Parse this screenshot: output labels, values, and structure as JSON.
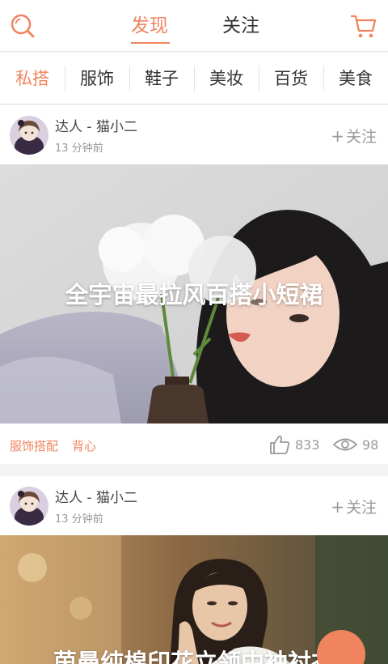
{
  "header": {
    "tabs": [
      {
        "label": "发现",
        "active": true
      },
      {
        "label": "关注",
        "active": false
      }
    ],
    "search_icon": "search-icon",
    "cart_icon": "cart-icon"
  },
  "categories": [
    {
      "label": "私搭",
      "active": true
    },
    {
      "label": "服饰",
      "active": false
    },
    {
      "label": "鞋子",
      "active": false
    },
    {
      "label": "美妆",
      "active": false
    },
    {
      "label": "百货",
      "active": false
    },
    {
      "label": "美食",
      "active": false
    }
  ],
  "posts": [
    {
      "author": "达人 - 猫小二",
      "time": "13 分钟前",
      "follow": "关注",
      "title": "全宇宙最拉风百搭小短裙",
      "tags": [
        "服饰搭配",
        "背心"
      ],
      "likes": "833",
      "views": "98"
    },
    {
      "author": "达人 - 猫小二",
      "time": "13 分钟前",
      "follow": "关注",
      "title": "茵曼纯棉印花立领中袖衬衣"
    }
  ],
  "colors": {
    "accent": "#f0845f",
    "text": "#333333",
    "muted": "#999999"
  }
}
